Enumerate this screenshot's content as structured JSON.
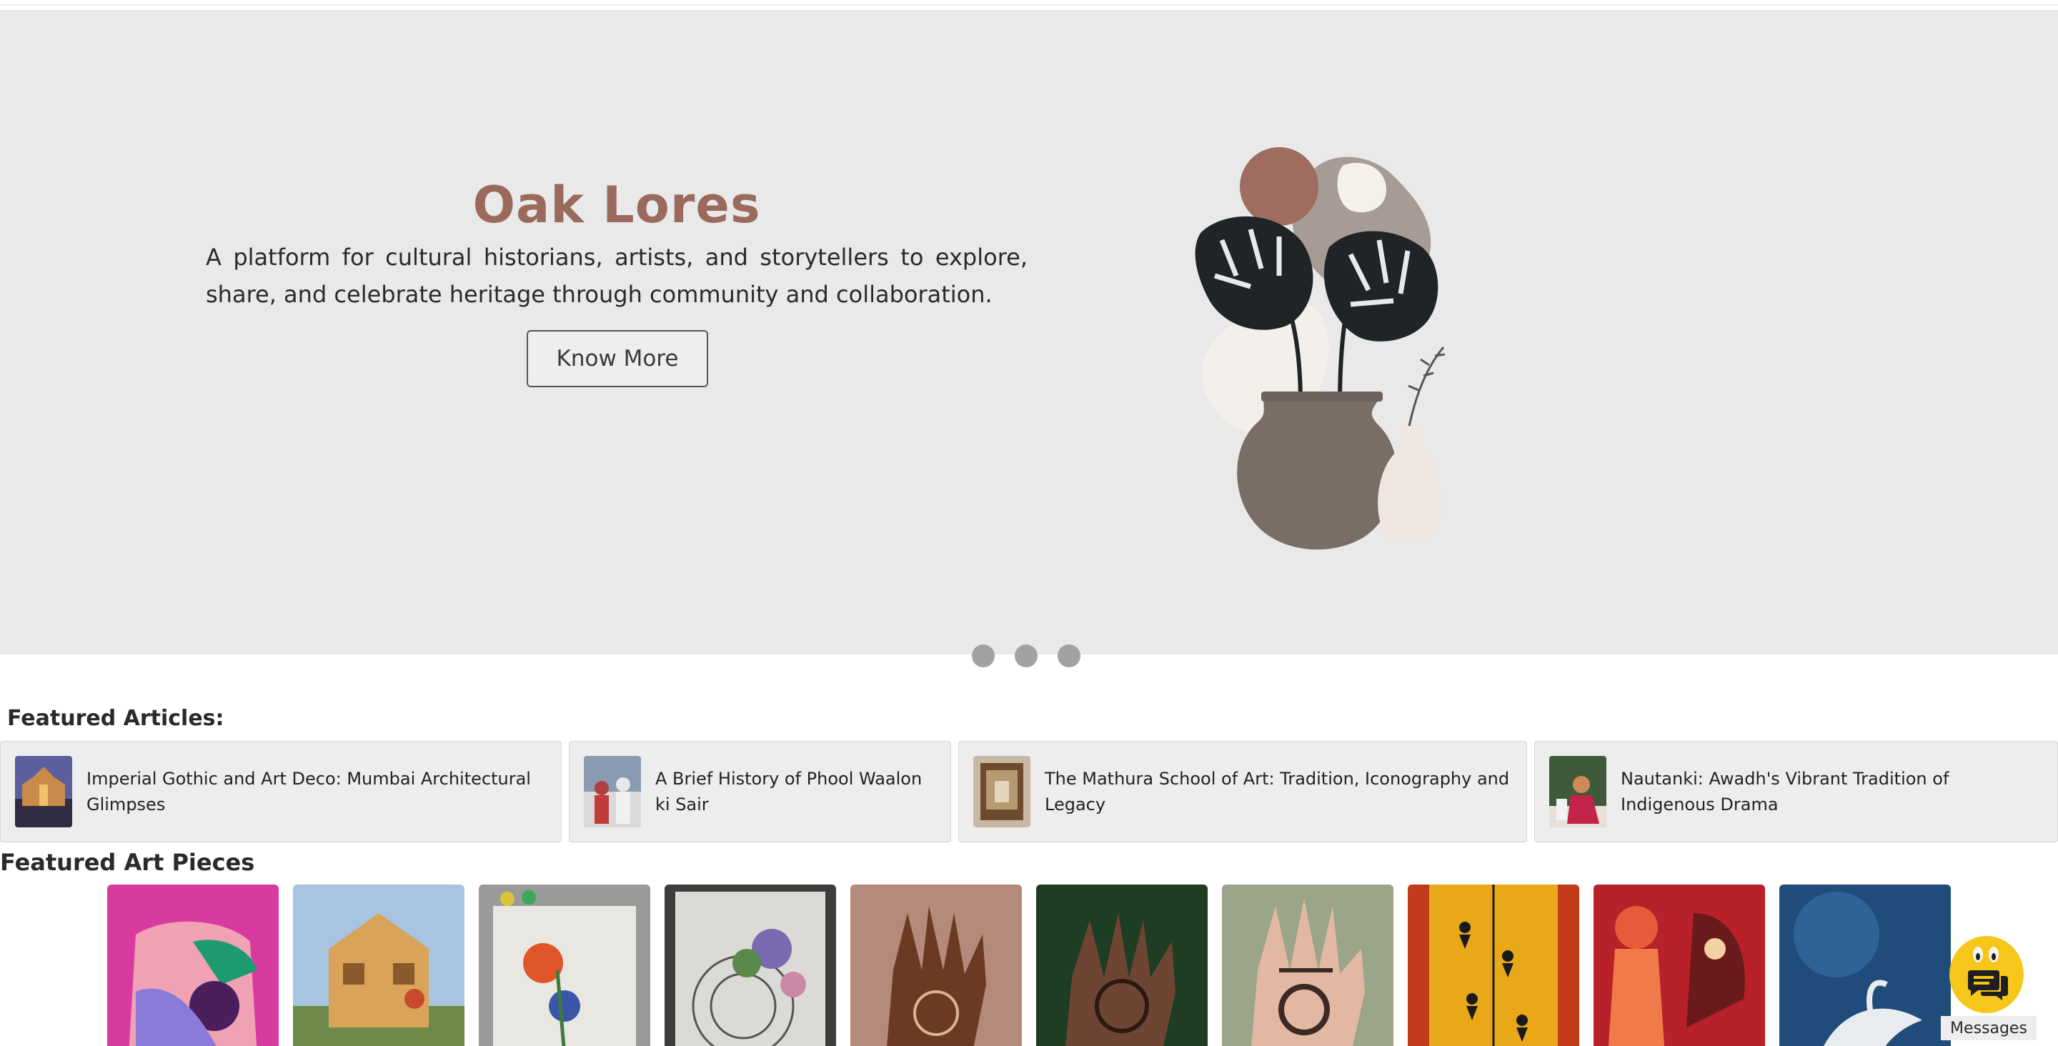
{
  "hero": {
    "title": "Oak Lores",
    "description": "A platform for cultural historians, artists, and storytellers to explore, share, and celebrate heritage through community and collaboration.",
    "button_label": "Know More",
    "slide_count": 3,
    "illustration": "plant-vase-illustration"
  },
  "featured_articles": {
    "title": "Featured Articles:",
    "items": [
      {
        "label": "Imperial Gothic and Art Deco: Mumbai Architectural Glimpses",
        "thumb": "mumbai-building-thumb"
      },
      {
        "label": "A Brief History of Phool Waalon ki Sair",
        "thumb": "festival-thumb"
      },
      {
        "label": "The Mathura School of Art: Tradition, Iconography and Legacy",
        "thumb": "museum-thumb"
      },
      {
        "label": "Nautanki: Awadh's Vibrant Tradition of Indigenous Drama",
        "thumb": "drama-thumb"
      }
    ]
  },
  "featured_art": {
    "title": "Featured Art Pieces",
    "items": [
      "abstract-pink-art",
      "wooden-house-model",
      "flower-painting",
      "mandala-sketch",
      "mehndi-hand-1",
      "mehndi-hand-2",
      "mehndi-hand-3",
      "warli-painting",
      "kerala-mural",
      "swan-painting"
    ]
  },
  "messages": {
    "label": "Messages",
    "icon": "chat-icon"
  },
  "colors": {
    "hero_bg": "#e9e9e9",
    "title": "#9a6a5c",
    "accent_yellow": "#f6c61a"
  }
}
